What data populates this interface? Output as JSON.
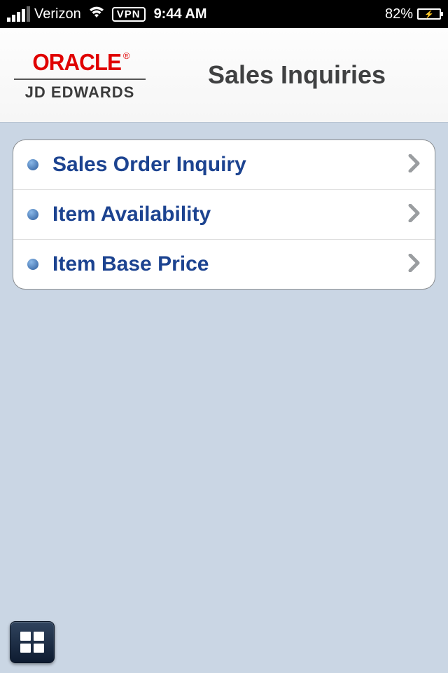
{
  "status": {
    "carrier": "Verizon",
    "vpn": "VPN",
    "time": "9:44 AM",
    "battery_pct": "82%"
  },
  "header": {
    "brand_primary": "ORACLE",
    "brand_secondary": "JD EDWARDS",
    "title": "Sales Inquiries"
  },
  "menu": {
    "items": [
      {
        "label": "Sales Order Inquiry"
      },
      {
        "label": "Item Availability"
      },
      {
        "label": "Item Base Price"
      }
    ]
  }
}
